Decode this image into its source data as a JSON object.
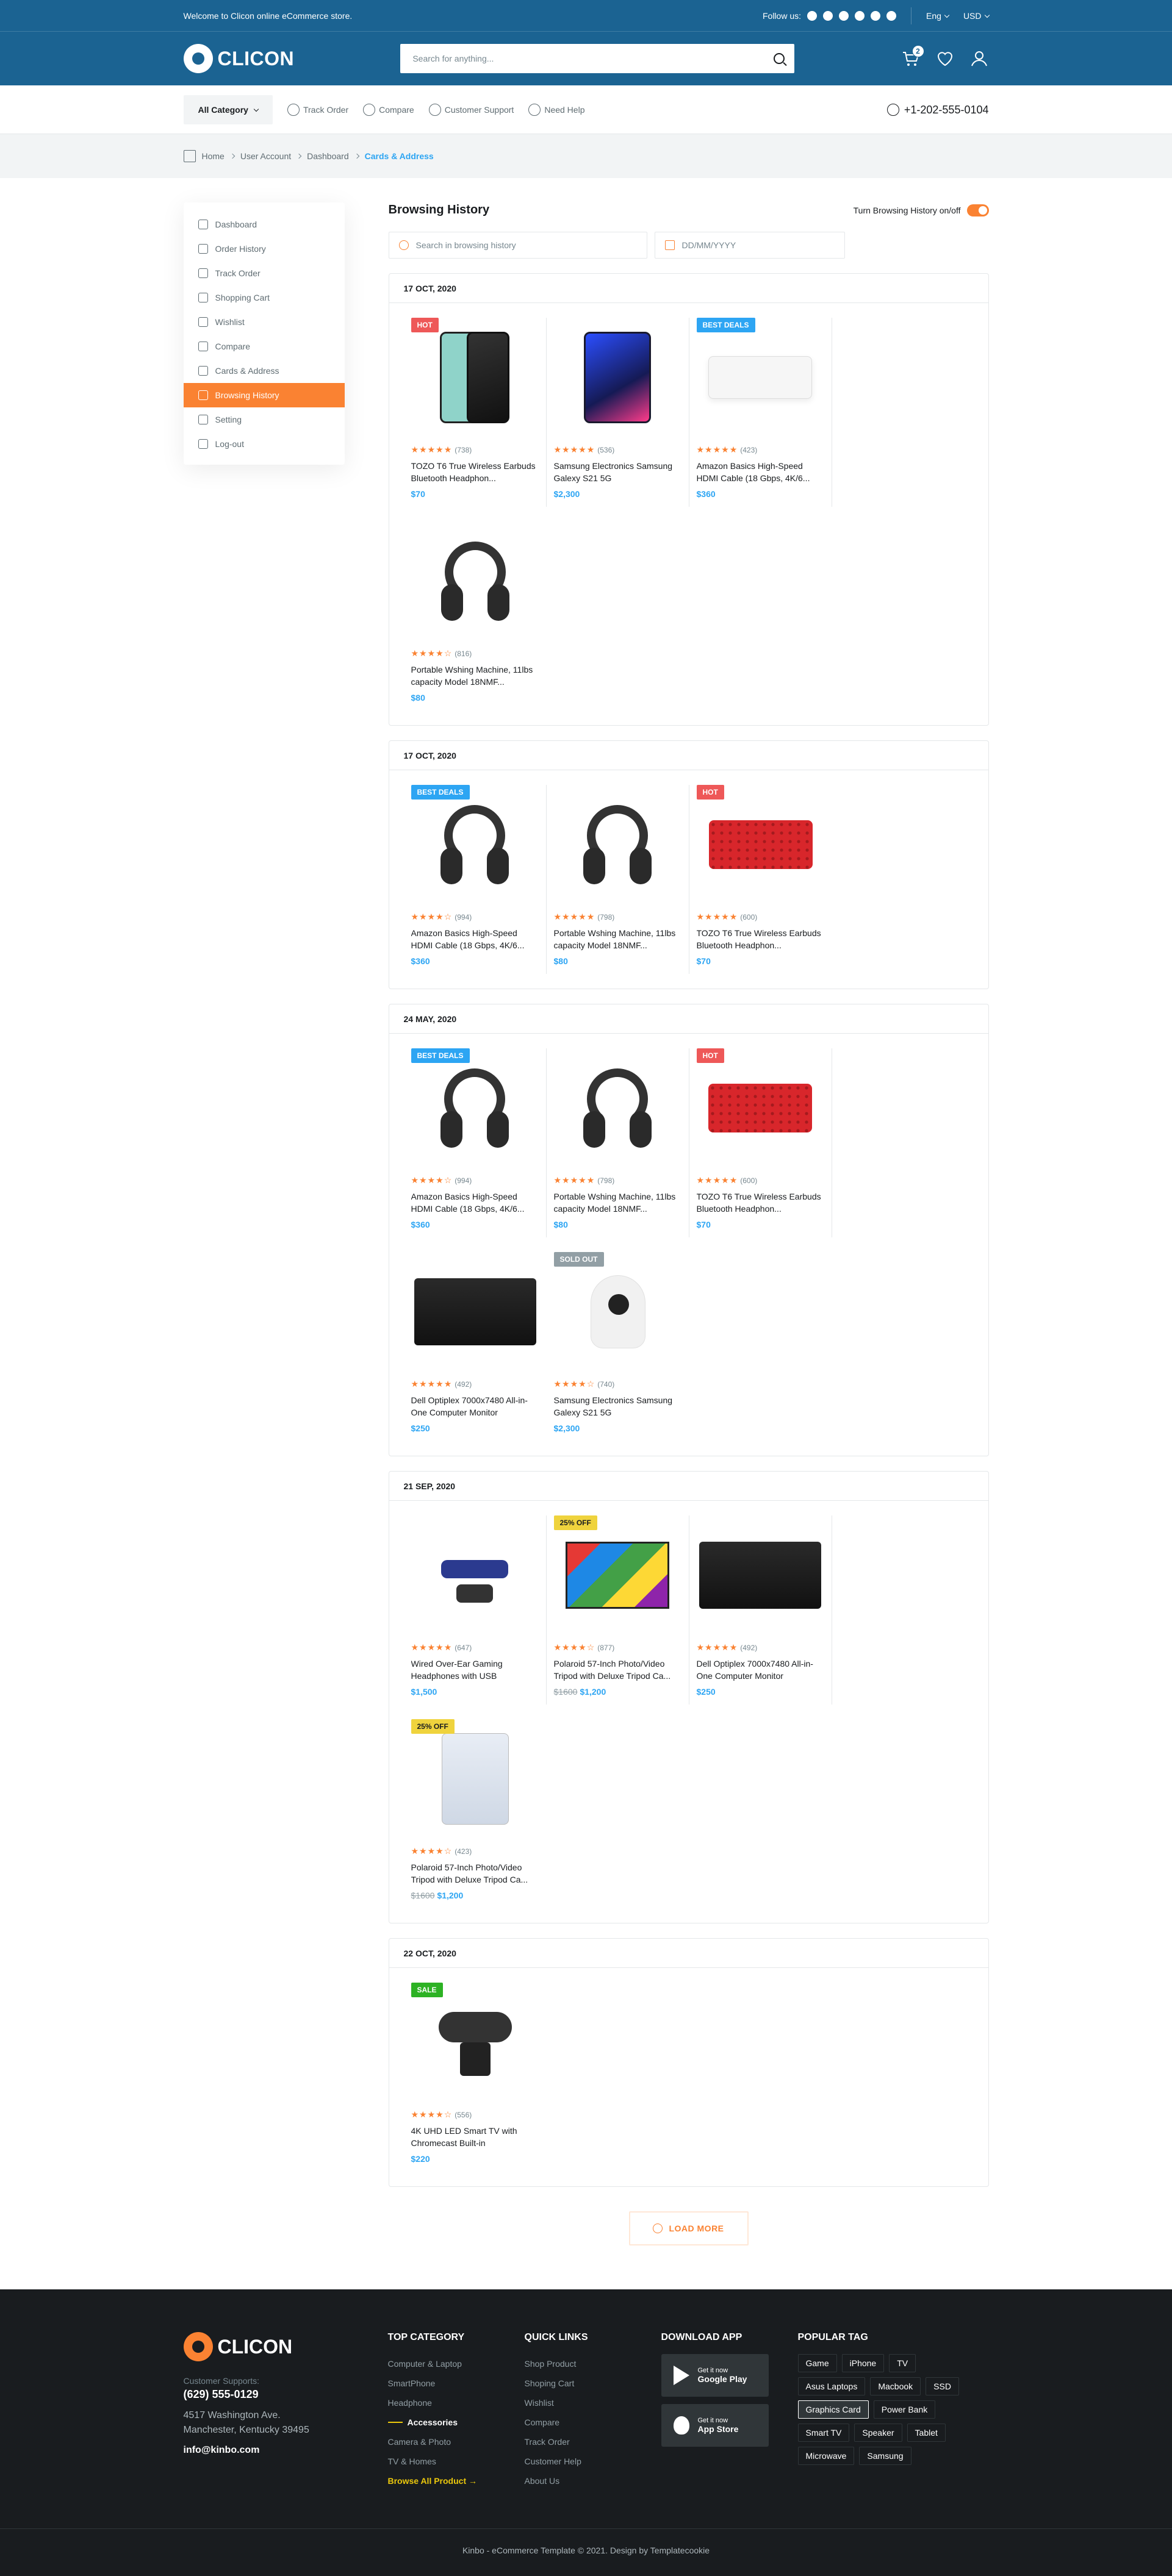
{
  "topbar": {
    "welcome": "Welcome to Clicon online eCommerce store.",
    "follow": "Follow us:",
    "lang": "Eng",
    "currency": "USD"
  },
  "header": {
    "logo": "CLICON",
    "search_placeholder": "Search for anything...",
    "cart_count": "2"
  },
  "nav": {
    "all_category": "All Category",
    "links": [
      "Track Order",
      "Compare",
      "Customer Support",
      "Need Help"
    ],
    "phone": "+1-202-555-0104"
  },
  "breadcrumb": [
    "Home",
    "User Account",
    "Dashboard",
    "Cards & Address"
  ],
  "sidebar": [
    "Dashboard",
    "Order History",
    "Track Order",
    "Shopping Cart",
    "Wishlist",
    "Compare",
    "Cards & Address",
    "Browsing History",
    "Setting",
    "Log-out"
  ],
  "history": {
    "title": "Browsing History",
    "toggle_label": "Turn Browsing History on/off",
    "search_placeholder": "Search in browsing history",
    "date_placeholder": "DD/MM/YYYY",
    "load_more": "LOAD MORE"
  },
  "groups": [
    {
      "date": "17 OCT, 2020",
      "items": [
        {
          "tag": "HOT",
          "tagc": "hot",
          "art": "phones",
          "stars": "★★★★★",
          "count": "(738)",
          "name": "TOZO T6 True Wireless Earbuds Bluetooth Headphon...",
          "price": "$70"
        },
        {
          "tag": "",
          "tagc": "",
          "art": "phone-blue",
          "stars": "★★★★★",
          "count": "(536)",
          "name": "Samsung Electronics Samsung Galexy S21 5G",
          "price": "$2,300"
        },
        {
          "tag": "BEST DEALS",
          "tagc": "best",
          "art": "ac",
          "stars": "★★★★★",
          "count": "(423)",
          "name": "Amazon Basics High-Speed HDMI Cable (18 Gbps, 4K/6...",
          "price": "$360"
        },
        {
          "tag": "",
          "tagc": "",
          "art": "hp",
          "stars": "★★★★☆",
          "count": "(816)",
          "name": "Portable Wshing Machine, 11lbs capacity Model 18NMF...",
          "price": "$80"
        }
      ]
    },
    {
      "date": "17 OCT, 2020",
      "items": [
        {
          "tag": "BEST DEALS",
          "tagc": "best",
          "art": "hp",
          "stars": "★★★★☆",
          "count": "(994)",
          "name": "Amazon Basics High-Speed HDMI Cable (18 Gbps, 4K/6...",
          "price": "$360"
        },
        {
          "tag": "",
          "tagc": "",
          "art": "hp",
          "stars": "★★★★★",
          "count": "(798)",
          "name": "Portable Wshing Machine, 11lbs capacity Model 18NMF...",
          "price": "$80"
        },
        {
          "tag": "HOT",
          "tagc": "hot",
          "art": "kb",
          "stars": "★★★★★",
          "count": "(600)",
          "name": "TOZO T6 True Wireless Earbuds Bluetooth Headphon...",
          "price": "$70"
        }
      ]
    },
    {
      "date": "24 MAY, 2020",
      "items": [
        {
          "tag": "BEST DEALS",
          "tagc": "best",
          "art": "hp",
          "stars": "★★★★☆",
          "count": "(994)",
          "name": "Amazon Basics High-Speed HDMI Cable (18 Gbps, 4K/6...",
          "price": "$360"
        },
        {
          "tag": "",
          "tagc": "",
          "art": "hp",
          "stars": "★★★★★",
          "count": "(798)",
          "name": "Portable Wshing Machine, 11lbs capacity Model 18NMF...",
          "price": "$80"
        },
        {
          "tag": "HOT",
          "tagc": "hot",
          "art": "kb",
          "stars": "★★★★★",
          "count": "(600)",
          "name": "TOZO T6 True Wireless Earbuds Bluetooth Headphon...",
          "price": "$70"
        },
        {
          "tag": "",
          "tagc": "",
          "art": "printer",
          "stars": "★★★★★",
          "count": "(492)",
          "name": "Dell Optiplex 7000x7480 All-in-One Computer Monitor",
          "price": "$250"
        },
        {
          "tag": "SOLD OUT",
          "tagc": "sold",
          "art": "cam",
          "stars": "★★★★☆",
          "count": "(740)",
          "name": "Samsung Electronics Samsung Galexy S21 5G",
          "price": "$2,300"
        }
      ]
    },
    {
      "date": "21 SEP, 2020",
      "items": [
        {
          "tag": "",
          "tagc": "",
          "art": "drone",
          "stars": "★★★★★",
          "count": "(647)",
          "name": "Wired Over-Ear Gaming Headphones with USB",
          "price": "$1,500"
        },
        {
          "tag": "25% OFF",
          "tagc": "off",
          "art": "tv",
          "stars": "★★★★☆",
          "count": "(877)",
          "name": "Polaroid 57-Inch Photo/Video Tripod with Deluxe Tripod Ca...",
          "old": "$1600",
          "price": "$1,200"
        },
        {
          "tag": "",
          "tagc": "",
          "art": "printer",
          "stars": "★★★★★",
          "count": "(492)",
          "name": "Dell Optiplex 7000x7480 All-in-One Computer Monitor",
          "price": "$250"
        },
        {
          "tag": "25% OFF",
          "tagc": "off",
          "art": "washer",
          "stars": "★★★★☆",
          "count": "(423)",
          "name": "Polaroid 57-Inch Photo/Video Tripod with Deluxe Tripod Ca...",
          "old": "$1600",
          "price": "$1,200"
        }
      ]
    },
    {
      "date": "22 OCT, 2020",
      "items": [
        {
          "tag": "SALE",
          "tagc": "sale",
          "art": "webcam",
          "stars": "★★★★☆",
          "count": "(556)",
          "name": "4K UHD LED Smart TV with Chromecast Built-in",
          "price": "$220"
        }
      ]
    }
  ],
  "footer": {
    "logo": "CLICON",
    "support_label": "Customer Supports:",
    "phone": "(629) 555-0129",
    "address": "4517 Washington Ave. Manchester, Kentucky 39495",
    "email": "info@kinbo.com",
    "top_category": {
      "title": "Top Category",
      "links": [
        "Computer & Laptop",
        "SmartPhone",
        "Headphone",
        "Accessories",
        "Camera & Photo",
        "TV & Homes"
      ],
      "browse": "Browse All Product"
    },
    "quick_links": {
      "title": "Quick links",
      "links": [
        "Shop Product",
        "Shoping Cart",
        "Wishlist",
        "Compare",
        "Track Order",
        "Customer Help",
        "About Us"
      ]
    },
    "download": {
      "title": "Download APP",
      "google_label": "Get it now",
      "google": "Google Play",
      "apple_label": "Get it now",
      "apple": "App Store"
    },
    "popular": {
      "title": "Popular Tag",
      "tags": [
        "Game",
        "iPhone",
        "TV",
        "Asus Laptops",
        "Macbook",
        "SSD",
        "Graphics Card",
        "Power Bank",
        "Smart TV",
        "Speaker",
        "Tablet",
        "Microwave",
        "Samsung"
      ]
    },
    "copyright": "Kinbo - eCommerce Template © 2021. Design by Templatecookie"
  }
}
